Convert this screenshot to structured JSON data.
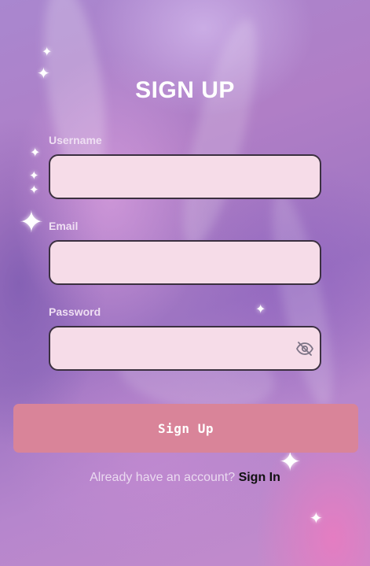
{
  "page": {
    "title": "SIGN UP"
  },
  "form": {
    "username": {
      "label": "Username",
      "value": "",
      "placeholder": ""
    },
    "email": {
      "label": "Email",
      "value": "",
      "placeholder": ""
    },
    "password": {
      "label": "Password",
      "value": "",
      "placeholder": "",
      "toggle_icon": "eye-slash-icon"
    },
    "submit_label": "Sign Up"
  },
  "footer": {
    "prompt": "Already have an account?",
    "link_label": "Sign In"
  },
  "colors": {
    "field_background": "#f6dce8",
    "field_border": "#3b3040",
    "button_background": "#d98499",
    "link_color": "#111111"
  }
}
